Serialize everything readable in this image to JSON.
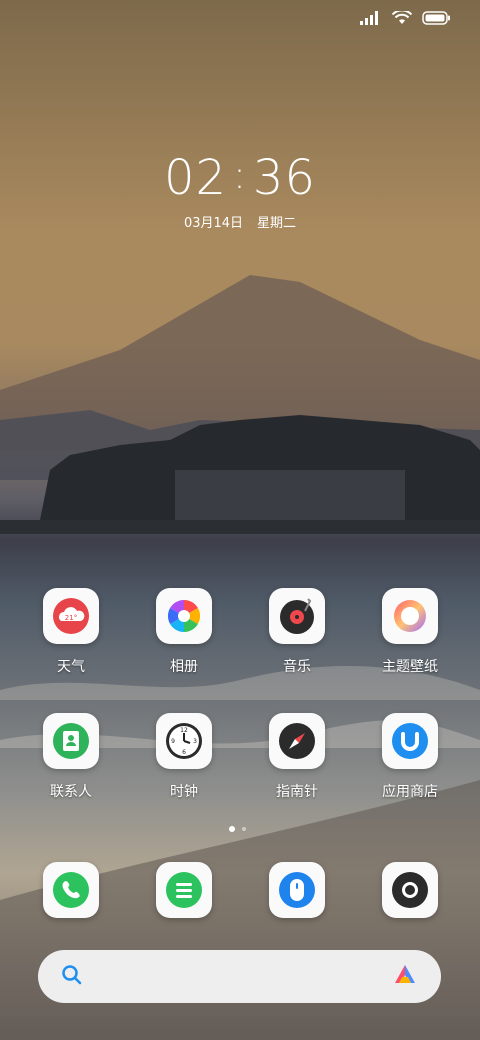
{
  "status_bar": {
    "icons": [
      "signal-icon",
      "wifi-icon",
      "battery-icon"
    ]
  },
  "lock_clock": {
    "hour": "02",
    "separator": ":",
    "minute": "36",
    "date": "03月14日",
    "weekday": "星期二"
  },
  "apps": [
    {
      "label": "天气",
      "icon": "weather-icon",
      "badge": "21°"
    },
    {
      "label": "相册",
      "icon": "gallery-icon"
    },
    {
      "label": "音乐",
      "icon": "music-icon"
    },
    {
      "label": "主题壁纸",
      "icon": "themes-icon"
    },
    {
      "label": "联系人",
      "icon": "contacts-icon"
    },
    {
      "label": "时钟",
      "icon": "clock-icon",
      "dial_numbers": [
        "12",
        "3",
        "6",
        "9"
      ]
    },
    {
      "label": "指南针",
      "icon": "compass-icon"
    },
    {
      "label": "应用商店",
      "icon": "app-store-icon"
    }
  ],
  "dock": [
    {
      "icon": "phone-icon"
    },
    {
      "icon": "messages-icon"
    },
    {
      "icon": "browser-icon"
    },
    {
      "icon": "camera-icon"
    }
  ],
  "search": {
    "icon": "search-icon",
    "assistant_icon": "assistant-icon"
  },
  "pager": {
    "pages": 2,
    "current": 1
  },
  "colors": {
    "weather_red": "#e8454a",
    "contacts_green": "#2fb35a",
    "app_store_blue": "#1e8ef0",
    "phone_green": "#2cc35f",
    "browser_blue": "#1f83ee"
  }
}
